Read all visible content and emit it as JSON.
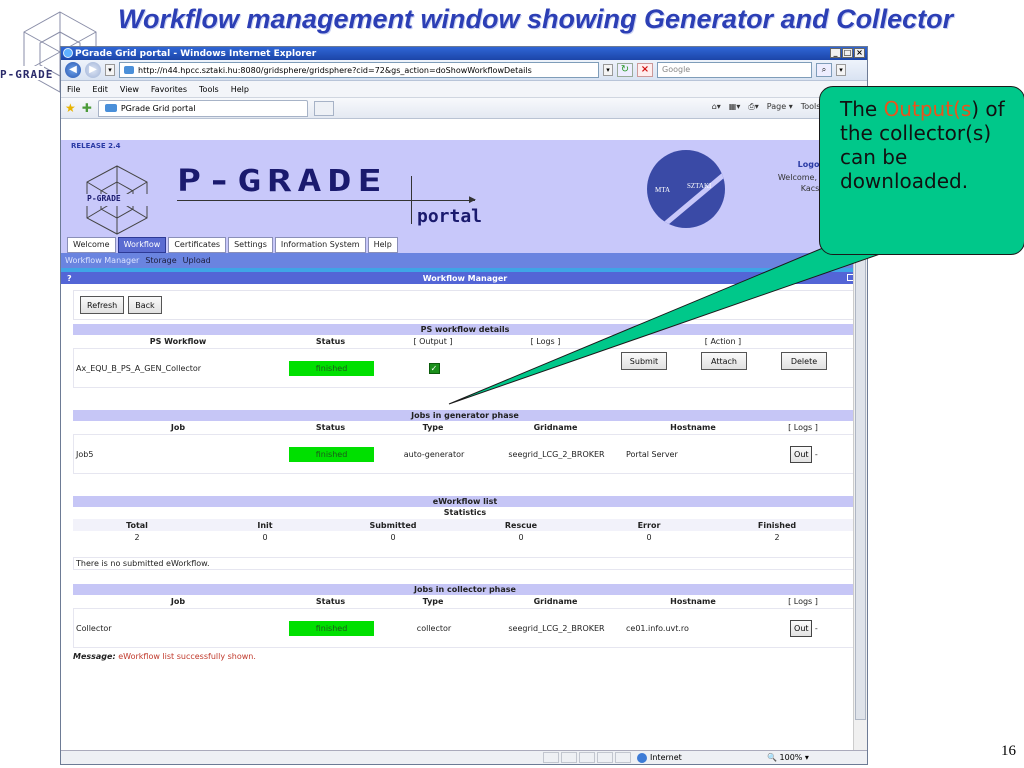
{
  "slide": {
    "title": "Workflow management window showing Generator and Collector",
    "page_number": "16",
    "corner_logo_text": "P-GRADE"
  },
  "browser": {
    "window_title": "PGrade Grid portal - Windows Internet Explorer",
    "url": "http://n44.hpcc.sztaki.hu:8080/gridsphere/gridsphere?cid=72&gs_action=doShowWorkflowDetails",
    "search_placeholder": "Google",
    "menu": [
      "File",
      "Edit",
      "View",
      "Favorites",
      "Tools",
      "Help"
    ],
    "tab_title": "PGrade Grid portal",
    "tools": [
      "Page ▾",
      "Tools ▾"
    ],
    "status_zone": "Internet",
    "zoom": "100%"
  },
  "portal": {
    "release": "RELEASE 2.4",
    "brand_word": "P-GRADE",
    "portal_word": "portal",
    "logo_text": "P-GRADE",
    "mta_left": "MTA",
    "mta_right": "SZTAKI",
    "logout": "Logout",
    "welcome_line1": "Welcome, Pe",
    "welcome_line2": "Kacsuk",
    "tabs": [
      "Welcome",
      "Workflow",
      "Certificates",
      "Settings",
      "Information System",
      "Help"
    ],
    "subnav": {
      "current": "Workflow Manager",
      "links": [
        "Storage",
        "Upload"
      ]
    },
    "panel_title": "Workflow Manager",
    "panel_help": "?"
  },
  "toolbar": {
    "refresh": "Refresh",
    "back": "Back"
  },
  "ps_details": {
    "section": "PS workflow details",
    "headers": [
      "PS Workflow",
      "Status",
      "[ Output ]",
      "[ Logs ]",
      "[ Action ]"
    ],
    "row": {
      "name": "Ax_EQU_B_PS_A_GEN_Collector",
      "status": "finished",
      "logs": "-",
      "actions": [
        "Submit",
        "Attach",
        "Delete"
      ]
    }
  },
  "generator": {
    "section": "Jobs in generator phase",
    "headers": [
      "Job",
      "Status",
      "Type",
      "Gridname",
      "Hostname",
      "[ Logs ]"
    ],
    "row": {
      "job": "Job5",
      "status": "finished",
      "type": "auto-generator",
      "gridname": "seegrid_LCG_2_BROKER",
      "hostname": "Portal Server",
      "out": "Out",
      "dash": "-"
    }
  },
  "eworkflow": {
    "section": "eWorkflow list",
    "stats_title": "Statistics",
    "headers": [
      "Total",
      "Init",
      "Submitted",
      "Rescue",
      "Error",
      "Finished"
    ],
    "values": [
      "2",
      "0",
      "0",
      "0",
      "0",
      "2"
    ],
    "note": "There is no submitted eWorkflow."
  },
  "collector": {
    "section": "Jobs in collector phase",
    "headers": [
      "Job",
      "Status",
      "Type",
      "Gridname",
      "Hostname",
      "[ Logs ]"
    ],
    "row": {
      "job": "Collector",
      "status": "finished",
      "type": "collector",
      "gridname": "seegrid_LCG_2_BROKER",
      "hostname": "ce01.info.uvt.ro",
      "out": "Out",
      "dash": "-"
    }
  },
  "message": {
    "label": "Message:",
    "text": "eWorkflow list successfully shown."
  },
  "callout": {
    "prefix": "The ",
    "highlight": "Output(s",
    "suffix": ") of the collector(s) can be downloaded."
  },
  "colors": {
    "finished": "#00e000",
    "callout": "#00c88a",
    "highlight": "#e8541c",
    "title": "#2c3fb5"
  }
}
